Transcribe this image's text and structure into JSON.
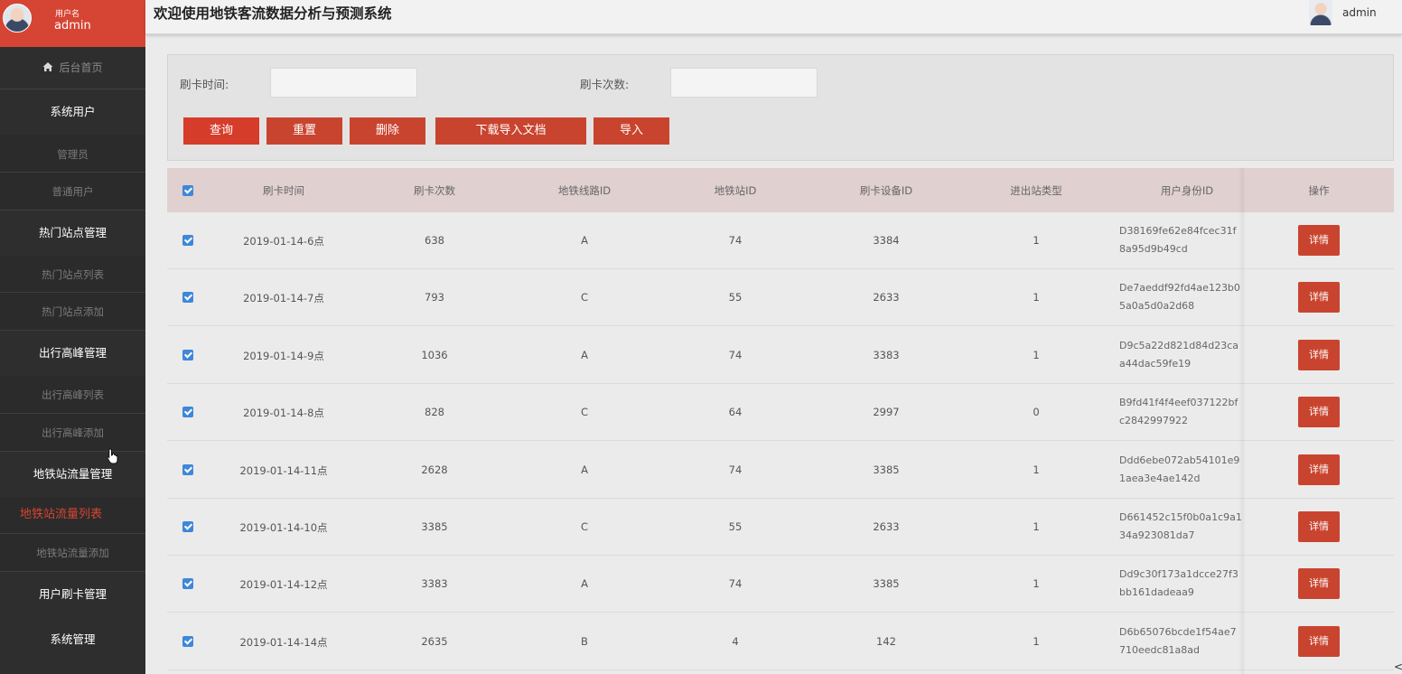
{
  "sidebar": {
    "user_caption": "用户名",
    "user_name": "admin",
    "home": "后台首页",
    "groups": [
      {
        "label": "系统用户",
        "items": [
          "管理员",
          "普通用户"
        ]
      },
      {
        "label": "热门站点管理",
        "items": [
          "热门站点列表",
          "热门站点添加"
        ]
      },
      {
        "label": "出行高峰管理",
        "items": [
          "出行高峰列表",
          "出行高峰添加"
        ]
      },
      {
        "label": "地铁站流量管理",
        "items": [
          "地铁站流量列表",
          "地铁站流量添加"
        ]
      },
      {
        "label": "用户刷卡管理",
        "items": []
      },
      {
        "label": "系统管理",
        "items": []
      }
    ],
    "active_item": "地铁站流量列表"
  },
  "header": {
    "title": "欢迎使用地铁客流数据分析与预测系统",
    "user": "admin"
  },
  "search": {
    "time_label": "刷卡时间:",
    "time_value": "",
    "count_label": "刷卡次数:",
    "count_value": "",
    "buttons": {
      "query": "查询",
      "reset": "重置",
      "delete": "删除",
      "download": "下载导入文档",
      "import": "导入"
    }
  },
  "table": {
    "columns": [
      "刷卡时间",
      "刷卡次数",
      "地铁线路ID",
      "地铁站ID",
      "刷卡设备ID",
      "进出站类型",
      "用户身份ID",
      "操作"
    ],
    "action_label": "详情",
    "rows": [
      {
        "time": "2019-01-14-6点",
        "count": "638",
        "line": "A",
        "station": "74",
        "device": "3384",
        "type": "1",
        "uid": "D38169fe62e84fcec31f8a95d9b49cd"
      },
      {
        "time": "2019-01-14-7点",
        "count": "793",
        "line": "C",
        "station": "55",
        "device": "2633",
        "type": "1",
        "uid": "De7aeddf92fd4ae123b05a0a5d0a2d68"
      },
      {
        "time": "2019-01-14-9点",
        "count": "1036",
        "line": "A",
        "station": "74",
        "device": "3383",
        "type": "1",
        "uid": "D9c5a22d821d84d23caa44dac59fe19"
      },
      {
        "time": "2019-01-14-8点",
        "count": "828",
        "line": "C",
        "station": "64",
        "device": "2997",
        "type": "0",
        "uid": "B9fd41f4f4eef037122bfc2842997922"
      },
      {
        "time": "2019-01-14-11点",
        "count": "2628",
        "line": "A",
        "station": "74",
        "device": "3385",
        "type": "1",
        "uid": "Ddd6ebe072ab54101e91aea3e4ae142d"
      },
      {
        "time": "2019-01-14-10点",
        "count": "3385",
        "line": "C",
        "station": "55",
        "device": "2633",
        "type": "1",
        "uid": "D661452c15f0b0a1c9a134a923081da7"
      },
      {
        "time": "2019-01-14-12点",
        "count": "3383",
        "line": "A",
        "station": "74",
        "device": "3385",
        "type": "1",
        "uid": "Dd9c30f173a1dcce27f3bb161dadeaa9"
      },
      {
        "time": "2019-01-14-14点",
        "count": "2635",
        "line": "B",
        "station": "4",
        "device": "142",
        "type": "1",
        "uid": "D6b65076bcde1f54ae7710eedc81a8ad"
      }
    ]
  },
  "colors": {
    "accent": "#d64533",
    "sidebar": "#2e2e2e",
    "checkbox": "#3f87d9",
    "header_row": "#e0d0d0"
  },
  "icons": [
    "home-icon",
    "checkbox-checked-icon",
    "cursor-icon",
    "chevron-left-icon"
  ]
}
